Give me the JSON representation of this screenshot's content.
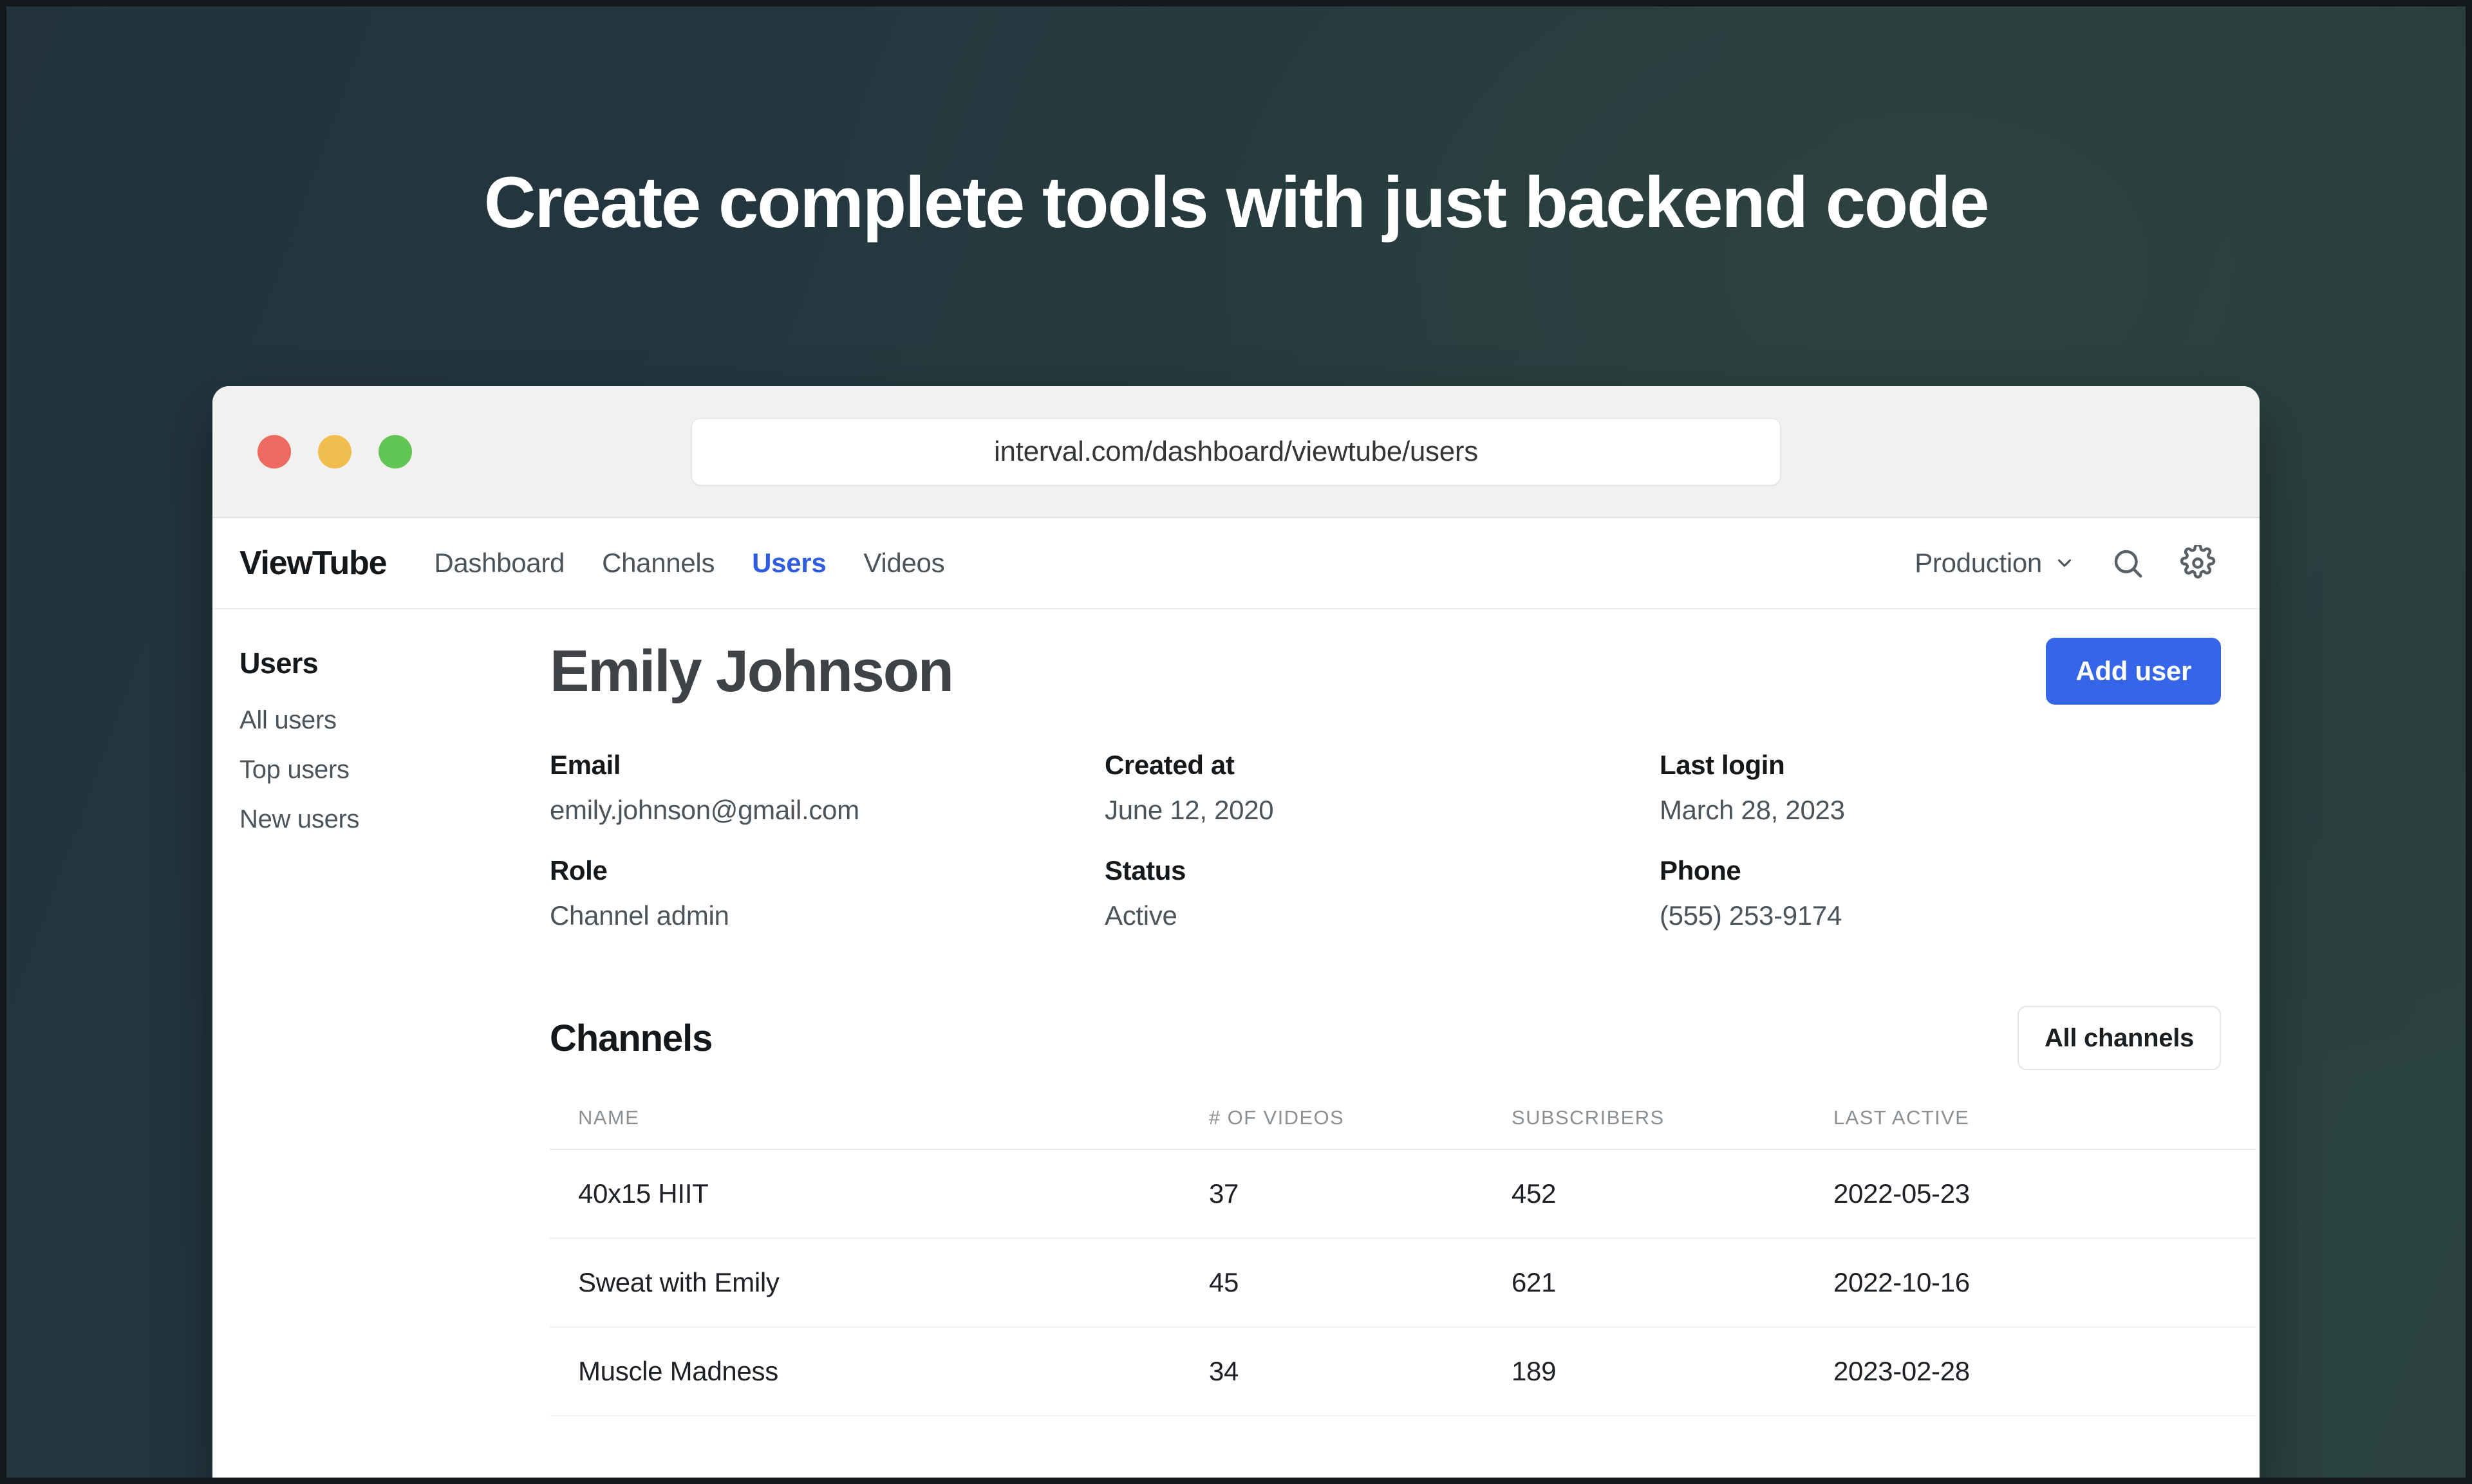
{
  "hero": {
    "headline": "Create complete tools with just backend code",
    "background_gradient_from": "#22333d",
    "background_gradient_to": "#2b4240"
  },
  "browser": {
    "traffic_lights": [
      {
        "name": "close",
        "color": "#ec6a5f"
      },
      {
        "name": "minimize",
        "color": "#f2bd4f"
      },
      {
        "name": "maximize",
        "color": "#61c554"
      }
    ],
    "url": "interval.com/dashboard/viewtube/users"
  },
  "app": {
    "brand": "ViewTube",
    "nav": [
      {
        "label": "Dashboard",
        "active": false
      },
      {
        "label": "Channels",
        "active": false
      },
      {
        "label": "Users",
        "active": true
      },
      {
        "label": "Videos",
        "active": false
      }
    ],
    "active_color": "#2f5ce0",
    "environment": "Production",
    "icons": {
      "chevron": "chevron-down-icon",
      "search": "search-icon",
      "settings": "gear-icon"
    }
  },
  "sidebar": {
    "title": "Users",
    "items": [
      {
        "label": "All users"
      },
      {
        "label": "Top users"
      },
      {
        "label": "New users"
      }
    ]
  },
  "page": {
    "title": "Emily Johnson",
    "primary_action": "Add user",
    "primary_action_color": "#3566e8",
    "fields": [
      {
        "label": "Email",
        "value": "emily.johnson@gmail.com"
      },
      {
        "label": "Created at",
        "value": "June 12, 2020"
      },
      {
        "label": "Last login",
        "value": "March 28, 2023"
      },
      {
        "label": "Role",
        "value": "Channel admin"
      },
      {
        "label": "Status",
        "value": "Active"
      },
      {
        "label": "Phone",
        "value": "(555) 253-9174"
      }
    ]
  },
  "channels_section": {
    "title": "Channels",
    "action": "All channels",
    "columns": [
      "NAME",
      "# OF VIDEOS",
      "SUBSCRIBERS",
      "LAST ACTIVE"
    ],
    "rows": [
      {
        "name": "40x15 HIIT",
        "videos": "37",
        "subscribers": "452",
        "last_active": "2022-05-23",
        "menu": "•••"
      },
      {
        "name": "Sweat with Emily",
        "videos": "45",
        "subscribers": "621",
        "last_active": "2022-10-16",
        "menu": "•••"
      },
      {
        "name": "Muscle Madness",
        "videos": "34",
        "subscribers": "189",
        "last_active": "2023-02-28",
        "menu": "•••"
      }
    ]
  }
}
